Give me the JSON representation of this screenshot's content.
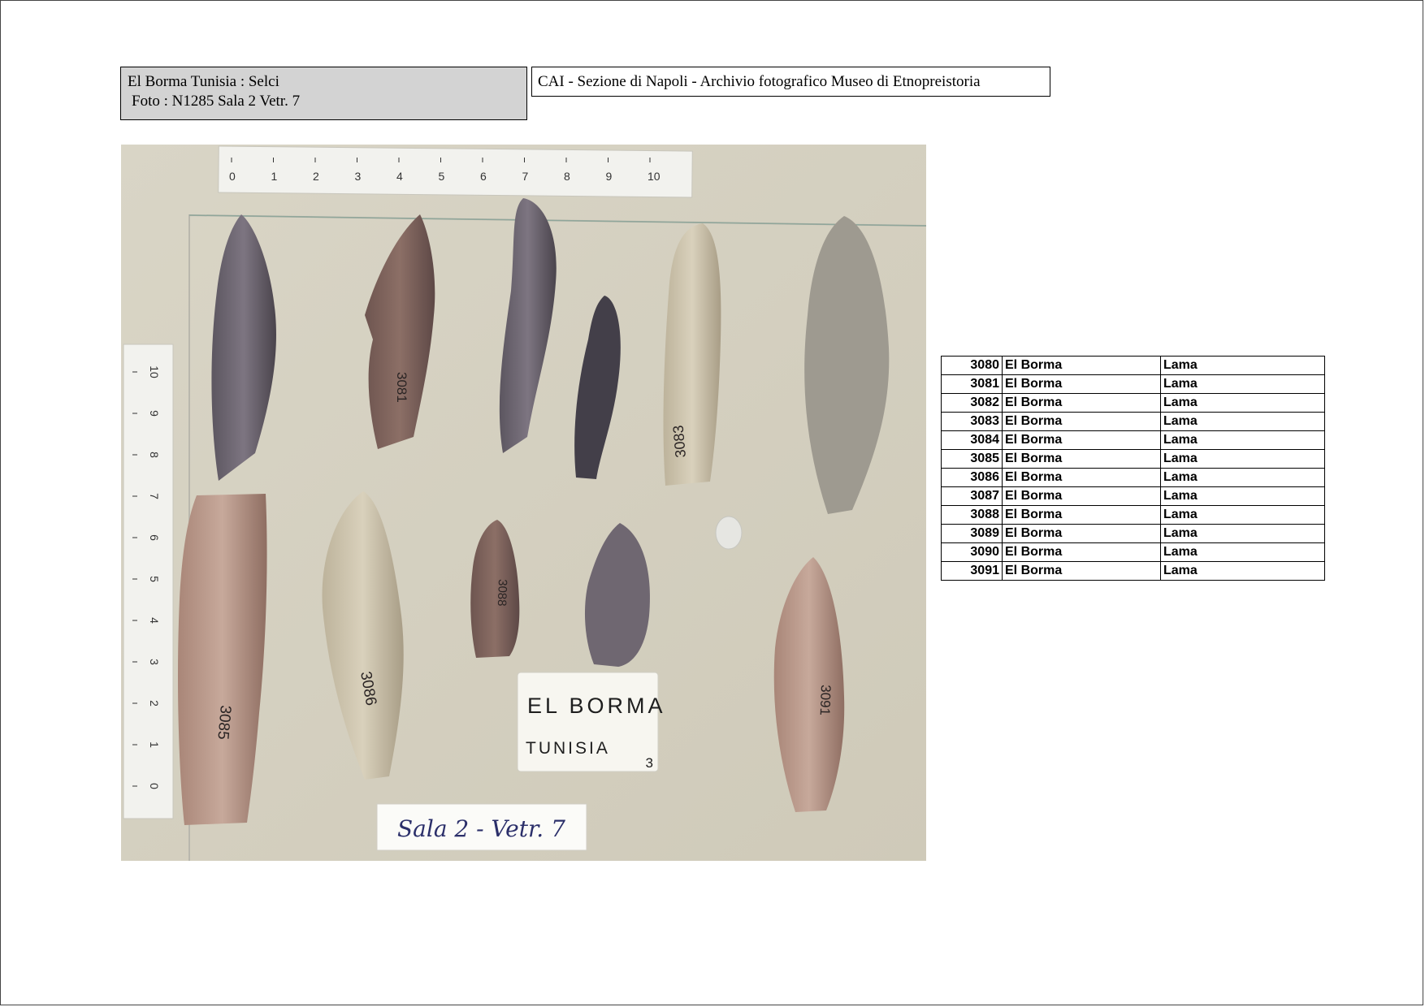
{
  "header": {
    "left_line1": "El Borma   Tunisia    :  Selci",
    "left_line2": "Foto : N1285  Sala 2 Vetr.  7",
    "right_title": "CAI - Sezione di Napoli  - Archivio fotografico Museo di Etnopreistoria"
  },
  "photo": {
    "ruler_top_ticks": [
      "0",
      "1",
      "2",
      "3",
      "4",
      "5",
      "6",
      "7",
      "8",
      "9",
      "10"
    ],
    "ruler_side_ticks": [
      "10",
      "9",
      "8",
      "7",
      "6",
      "5",
      "4",
      "3",
      "2",
      "1",
      "0"
    ],
    "label_card_line1": "EL BORMA",
    "label_card_line2": "TUNISIA",
    "label_card_number": "3",
    "room_label": "Sala 2 - Vetr. 7",
    "specimen_marks": [
      "3081",
      "3083",
      "3085",
      "3086",
      "3088",
      "3091"
    ],
    "colors": {
      "background": "#d8d4c4",
      "card": "#f7f6f0",
      "flint_dark": "#4e4a50",
      "flint_gray": "#6e6670",
      "flint_light": "#c9c1aa",
      "flint_brown": "#8a6a5c"
    }
  },
  "catalog": {
    "rows": [
      {
        "number": "3080",
        "site": "El Borma",
        "type": "Lama"
      },
      {
        "number": "3081",
        "site": "El Borma",
        "type": "Lama"
      },
      {
        "number": "3082",
        "site": "El Borma",
        "type": "Lama"
      },
      {
        "number": "3083",
        "site": "El Borma",
        "type": "Lama"
      },
      {
        "number": "3084",
        "site": "El Borma",
        "type": "Lama"
      },
      {
        "number": "3085",
        "site": "El Borma",
        "type": "Lama"
      },
      {
        "number": "3086",
        "site": "El Borma",
        "type": "Lama"
      },
      {
        "number": "3087",
        "site": "El Borma",
        "type": "Lama"
      },
      {
        "number": "3088",
        "site": "El Borma",
        "type": "Lama"
      },
      {
        "number": "3089",
        "site": "El Borma",
        "type": "Lama"
      },
      {
        "number": "3090",
        "site": "El Borma",
        "type": "Lama"
      },
      {
        "number": "3091",
        "site": "El Borma",
        "type": "Lama"
      }
    ]
  }
}
